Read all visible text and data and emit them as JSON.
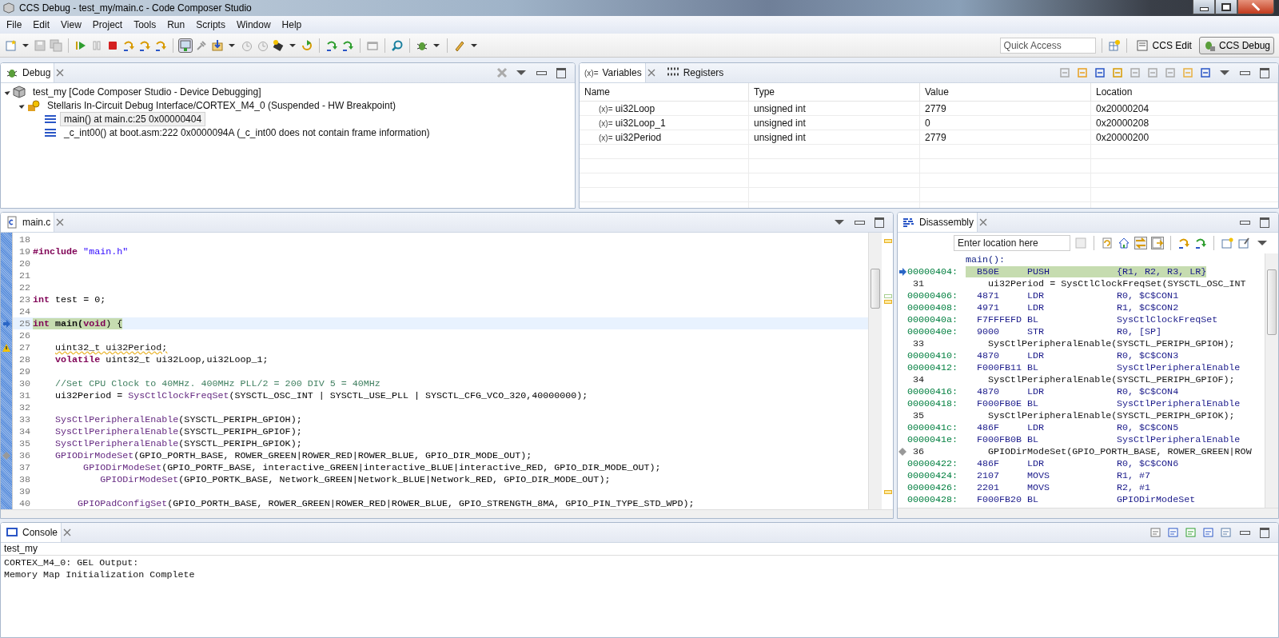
{
  "window": {
    "title": "CCS Debug - test_my/main.c - Code Composer Studio"
  },
  "menu": [
    "File",
    "Edit",
    "View",
    "Project",
    "Tools",
    "Run",
    "Scripts",
    "Window",
    "Help"
  ],
  "quick_access": {
    "placeholder": "Quick Access"
  },
  "perspectives": [
    {
      "label": "CCS Edit",
      "selected": false
    },
    {
      "label": "CCS Debug",
      "selected": true
    }
  ],
  "debug_view": {
    "tab": "Debug",
    "tree": [
      {
        "label": "test_my [Code Composer Studio - Device Debugging]",
        "expanded": true,
        "selected": false,
        "children": [
          {
            "label": "Stellaris In-Circuit Debug Interface/CORTEX_M4_0 (Suspended - HW Breakpoint)",
            "expanded": true,
            "selected": false,
            "children": [
              {
                "label": "main() at main.c:25 0x00000404",
                "selected": true
              },
              {
                "label": "_c_int00() at boot.asm:222 0x0000094A  (_c_int00 does not contain frame information)",
                "selected": false
              }
            ]
          }
        ]
      }
    ]
  },
  "variables_view": {
    "tabs": [
      {
        "label": "Variables",
        "icon_text": "(x)=",
        "selected": true
      },
      {
        "label": "Registers",
        "selected": false
      }
    ],
    "columns": [
      "Name",
      "Type",
      "Value",
      "Location"
    ],
    "rows": [
      {
        "prefix": "(x)=",
        "name": "ui32Loop",
        "type": "unsigned int",
        "value": "2779",
        "location": "0x20000204"
      },
      {
        "prefix": "(x)=",
        "name": "ui32Loop_1",
        "type": "unsigned int",
        "value": "0",
        "location": "0x20000208"
      },
      {
        "prefix": "(x)=",
        "name": "ui32Period",
        "type": "unsigned int",
        "value": "2779",
        "location": "0x20000200"
      }
    ]
  },
  "editor": {
    "tab": "main.c",
    "lines": [
      {
        "number": "18",
        "current": false,
        "warning": false,
        "breakpoint": false
      },
      {
        "number": "19",
        "current": false,
        "warning": false,
        "breakpoint": false,
        "parts": [
          {
            "kind": "keyword",
            "text": "#include"
          },
          {
            "kind": "string",
            "text": " \"main.h\""
          }
        ]
      },
      {
        "number": "20",
        "current": false,
        "warning": false,
        "breakpoint": false
      },
      {
        "number": "21",
        "current": false,
        "warning": false,
        "breakpoint": false
      },
      {
        "number": "22",
        "current": false,
        "warning": false,
        "breakpoint": false
      },
      {
        "number": "23",
        "current": false,
        "warning": false,
        "breakpoint": false,
        "parts": [
          {
            "kind": "keyword",
            "text": "int"
          },
          {
            "kind": "plain",
            "text": " test = 0;"
          }
        ]
      },
      {
        "number": "24",
        "current": false,
        "warning": false,
        "breakpoint": false
      },
      {
        "number": "25",
        "current": true,
        "warning": false,
        "breakpoint": false,
        "parts": [
          {
            "kind": "keyword",
            "text": "int"
          },
          {
            "kind": "bold",
            "text": " main("
          },
          {
            "kind": "keyword",
            "text": "void"
          },
          {
            "kind": "plain",
            "text": ") {"
          }
        ]
      },
      {
        "number": "26",
        "current": false,
        "warning": false,
        "breakpoint": false
      },
      {
        "number": "27",
        "current": false,
        "warning": true,
        "breakpoint": false,
        "parts": [
          {
            "kind": "squiggle",
            "text": "    uint32_t ui32Period;"
          }
        ]
      },
      {
        "number": "28",
        "current": false,
        "warning": false,
        "breakpoint": false,
        "parts": [
          {
            "kind": "keyword",
            "text": "    volatile"
          },
          {
            "kind": "plain",
            "text": " uint32_t ui32Loop,ui32Loop_1;"
          }
        ]
      },
      {
        "number": "29",
        "current": false,
        "warning": false,
        "breakpoint": false
      },
      {
        "number": "30",
        "current": false,
        "warning": false,
        "breakpoint": false,
        "parts": [
          {
            "kind": "comment",
            "text": "    //Set CPU Clock to 40MHz. 400MHz PLL/2 = 200 DIV 5 = 40MHz"
          }
        ]
      },
      {
        "number": "31",
        "current": false,
        "warning": false,
        "breakpoint": false,
        "parts": [
          {
            "kind": "plain",
            "text": "    ui32Period = "
          },
          {
            "kind": "function",
            "text": "SysCtlClockFreqSet"
          },
          {
            "kind": "plain",
            "text": "(SYSCTL_OSC_INT | SYSCTL_USE_PLL | SYSCTL_CFG_VCO_320,40000000);"
          }
        ]
      },
      {
        "number": "32",
        "current": false,
        "warning": false,
        "breakpoint": false
      },
      {
        "number": "33",
        "current": false,
        "warning": false,
        "breakpoint": false,
        "parts": [
          {
            "kind": "function",
            "text": "    SysCtlPeripheralEnable"
          },
          {
            "kind": "plain",
            "text": "(SYSCTL_PERIPH_GPIOH);"
          }
        ]
      },
      {
        "number": "34",
        "current": false,
        "warning": false,
        "breakpoint": false,
        "parts": [
          {
            "kind": "function",
            "text": "    SysCtlPeripheralEnable"
          },
          {
            "kind": "plain",
            "text": "(SYSCTL_PERIPH_GPIOF);"
          }
        ]
      },
      {
        "number": "35",
        "current": false,
        "warning": false,
        "breakpoint": false,
        "parts": [
          {
            "kind": "function",
            "text": "    SysCtlPeripheralEnable"
          },
          {
            "kind": "plain",
            "text": "(SYSCTL_PERIPH_GPIOK);"
          }
        ]
      },
      {
        "number": "36",
        "current": false,
        "warning": false,
        "breakpoint": true,
        "parts": [
          {
            "kind": "function",
            "text": "    GPIODirModeSet"
          },
          {
            "kind": "plain",
            "text": "(GPIO_PORTH_BASE, ROWER_GREEN|ROWER_RED|ROWER_BLUE, GPIO_DIR_MODE_OUT);"
          }
        ]
      },
      {
        "number": "37",
        "current": false,
        "warning": false,
        "breakpoint": false,
        "parts": [
          {
            "kind": "function",
            "text": "         GPIODirModeSet"
          },
          {
            "kind": "plain",
            "text": "(GPIO_PORTF_BASE, interactive_GREEN|interactive_BLUE|interactive_RED, GPIO_DIR_MODE_OUT);"
          }
        ]
      },
      {
        "number": "38",
        "current": false,
        "warning": false,
        "breakpoint": false,
        "parts": [
          {
            "kind": "function",
            "text": "            GPIODirModeSet"
          },
          {
            "kind": "plain",
            "text": "(GPIO_PORTK_BASE, Network_GREEN|Network_BLUE|Network_RED, GPIO_DIR_MODE_OUT);"
          }
        ]
      },
      {
        "number": "39",
        "current": false,
        "warning": false,
        "breakpoint": false
      },
      {
        "number": "40",
        "current": false,
        "warning": false,
        "breakpoint": false,
        "parts": [
          {
            "kind": "function",
            "text": "        GPIOPadConfigSet"
          },
          {
            "kind": "plain",
            "text": "(GPIO_PORTH_BASE, ROWER_GREEN|ROWER_RED|ROWER_BLUE, GPIO_STRENGTH_8MA, GPIO_PIN_TYPE_STD_WPD);"
          }
        ]
      }
    ]
  },
  "disassembly": {
    "tab": "Disassembly",
    "location": {
      "placeholder": "Enter location here"
    },
    "rows": [
      {
        "kind": "label",
        "text": "main():"
      },
      {
        "kind": "instr",
        "address": "00000404:",
        "opcode": "B50E",
        "mnemonic": "PUSH",
        "operands": "{R1, R2, R3, LR}",
        "current": true
      },
      {
        "kind": "source",
        "line": "31",
        "text": "ui32Period = SysCtlClockFreqSet(SYSCTL_OSC_INT",
        "breakpoint": false
      },
      {
        "kind": "instr",
        "address": "00000406:",
        "opcode": "4871",
        "mnemonic": "LDR",
        "operands": "R0, $C$CON1",
        "current": false
      },
      {
        "kind": "instr",
        "address": "00000408:",
        "opcode": "4971",
        "mnemonic": "LDR",
        "operands": "R1, $C$CON2",
        "current": false
      },
      {
        "kind": "instr",
        "address": "0000040a:",
        "opcode": "F7FFFEFD",
        "mnemonic": "BL",
        "operands": "SysCtlClockFreqSet",
        "current": false
      },
      {
        "kind": "instr",
        "address": "0000040e:",
        "opcode": "9000",
        "mnemonic": "STR",
        "operands": "R0, [SP]",
        "current": false
      },
      {
        "kind": "source",
        "line": "33",
        "text": "SysCtlPeripheralEnable(SYSCTL_PERIPH_GPIOH);",
        "breakpoint": false
      },
      {
        "kind": "instr",
        "address": "00000410:",
        "opcode": "4870",
        "mnemonic": "LDR",
        "operands": "R0, $C$CON3",
        "current": false
      },
      {
        "kind": "instr",
        "address": "00000412:",
        "opcode": "F000FB11",
        "mnemonic": "BL",
        "operands": "SysCtlPeripheralEnable",
        "current": false
      },
      {
        "kind": "source",
        "line": "34",
        "text": "SysCtlPeripheralEnable(SYSCTL_PERIPH_GPIOF);",
        "breakpoint": false
      },
      {
        "kind": "instr",
        "address": "00000416:",
        "opcode": "4870",
        "mnemonic": "LDR",
        "operands": "R0, $C$CON4",
        "current": false
      },
      {
        "kind": "instr",
        "address": "00000418:",
        "opcode": "F000FB0E",
        "mnemonic": "BL",
        "operands": "SysCtlPeripheralEnable",
        "current": false
      },
      {
        "kind": "source",
        "line": "35",
        "text": "SysCtlPeripheralEnable(SYSCTL_PERIPH_GPIOK);",
        "breakpoint": false
      },
      {
        "kind": "instr",
        "address": "0000041c:",
        "opcode": "486F",
        "mnemonic": "LDR",
        "operands": "R0, $C$CON5",
        "current": false
      },
      {
        "kind": "instr",
        "address": "0000041e:",
        "opcode": "F000FB0B",
        "mnemonic": "BL",
        "operands": "SysCtlPeripheralEnable",
        "current": false
      },
      {
        "kind": "source",
        "line": "36",
        "text": "GPIODirModeSet(GPIO_PORTH_BASE, ROWER_GREEN|ROW",
        "breakpoint": true
      },
      {
        "kind": "instr",
        "address": "00000422:",
        "opcode": "486F",
        "mnemonic": "LDR",
        "operands": "R0, $C$CON6",
        "current": false
      },
      {
        "kind": "instr",
        "address": "00000424:",
        "opcode": "2107",
        "mnemonic": "MOVS",
        "operands": "R1, #7",
        "current": false
      },
      {
        "kind": "instr",
        "address": "00000426:",
        "opcode": "2201",
        "mnemonic": "MOVS",
        "operands": "R2, #1",
        "current": false
      },
      {
        "kind": "instr",
        "address": "00000428:",
        "opcode": "F000FB20",
        "mnemonic": "BL",
        "operands": "GPIODirModeSet",
        "current": false
      }
    ]
  },
  "console": {
    "tab": "Console",
    "name": "test_my",
    "lines": [
      "CORTEX_M4_0: GEL Output:",
      "Memory Map Initialization Complete"
    ]
  }
}
